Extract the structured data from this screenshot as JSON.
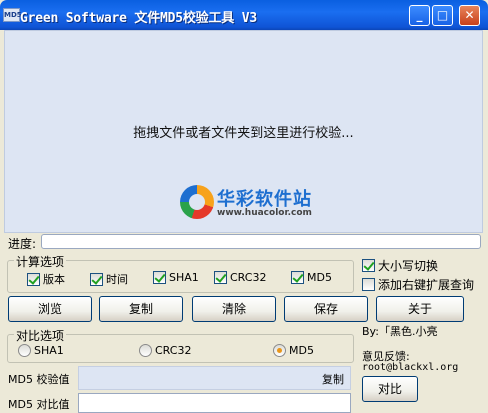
{
  "window": {
    "icon_text": "MD5",
    "title": "Green Software 文件MD5校验工具 V3",
    "minimize": "_",
    "maximize": "□",
    "close": "✕"
  },
  "dropzone": {
    "hint": "拖拽文件或者文件夹到这里进行校验...",
    "watermark_cn": "华彩软件站",
    "watermark_url": "www.huacolor.com"
  },
  "progress": {
    "label": "进度:",
    "value": 0
  },
  "calc_options": {
    "title": "计算选项",
    "items": [
      {
        "label": "版本",
        "checked": true
      },
      {
        "label": "时间",
        "checked": true
      },
      {
        "label": "SHA1",
        "checked": true
      },
      {
        "label": "CRC32",
        "checked": true
      },
      {
        "label": "MD5",
        "checked": true
      }
    ]
  },
  "extra_options": [
    {
      "label": "大小写切换",
      "checked": true
    },
    {
      "label": "添加右键扩展查询",
      "checked": false
    }
  ],
  "buttons": {
    "browse": "浏览",
    "copy": "复制",
    "clear": "清除",
    "save": "保存",
    "about": "关于"
  },
  "compare_options": {
    "title": "对比选项",
    "items": [
      {
        "label": "SHA1",
        "selected": false
      },
      {
        "label": "CRC32",
        "selected": false
      },
      {
        "label": "MD5",
        "selected": true
      }
    ]
  },
  "author": "By:「黑色.小亮",
  "feedback": {
    "label": "意见反馈:",
    "email": "root@blackxl.org"
  },
  "md5_result": {
    "label": "MD5 校验值",
    "copy_link": "复制"
  },
  "compare": {
    "label": "MD5 对比值",
    "button": "对比"
  }
}
